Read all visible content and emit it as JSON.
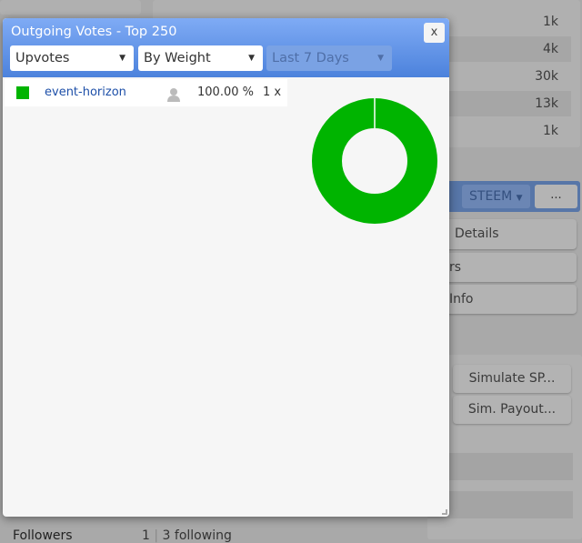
{
  "background": {
    "values": [
      "1k",
      "4k",
      "30k",
      "13k",
      "1k"
    ],
    "currency_select": "STEEM",
    "more_button": "...",
    "buttons": [
      "Details",
      "rs",
      "Info"
    ],
    "simulate_sp": "Simulate SP...",
    "sim_payout": "Sim. Payout...",
    "followers_label": "Followers",
    "followers_count": "1",
    "following": "3 following"
  },
  "modal": {
    "title": "Outgoing Votes - Top 250",
    "close": "x",
    "filters": {
      "type": "Upvotes",
      "sort": "By Weight",
      "period": "Last 7 Days"
    },
    "rows": [
      {
        "color": "#00b400",
        "name": "event-horizon",
        "percent": "100.00 %",
        "count": "1 x"
      }
    ]
  },
  "chart_data": {
    "type": "pie",
    "donut": true,
    "categories": [
      "event-horizon"
    ],
    "values": [
      100
    ],
    "colors": [
      "#00b400"
    ]
  }
}
